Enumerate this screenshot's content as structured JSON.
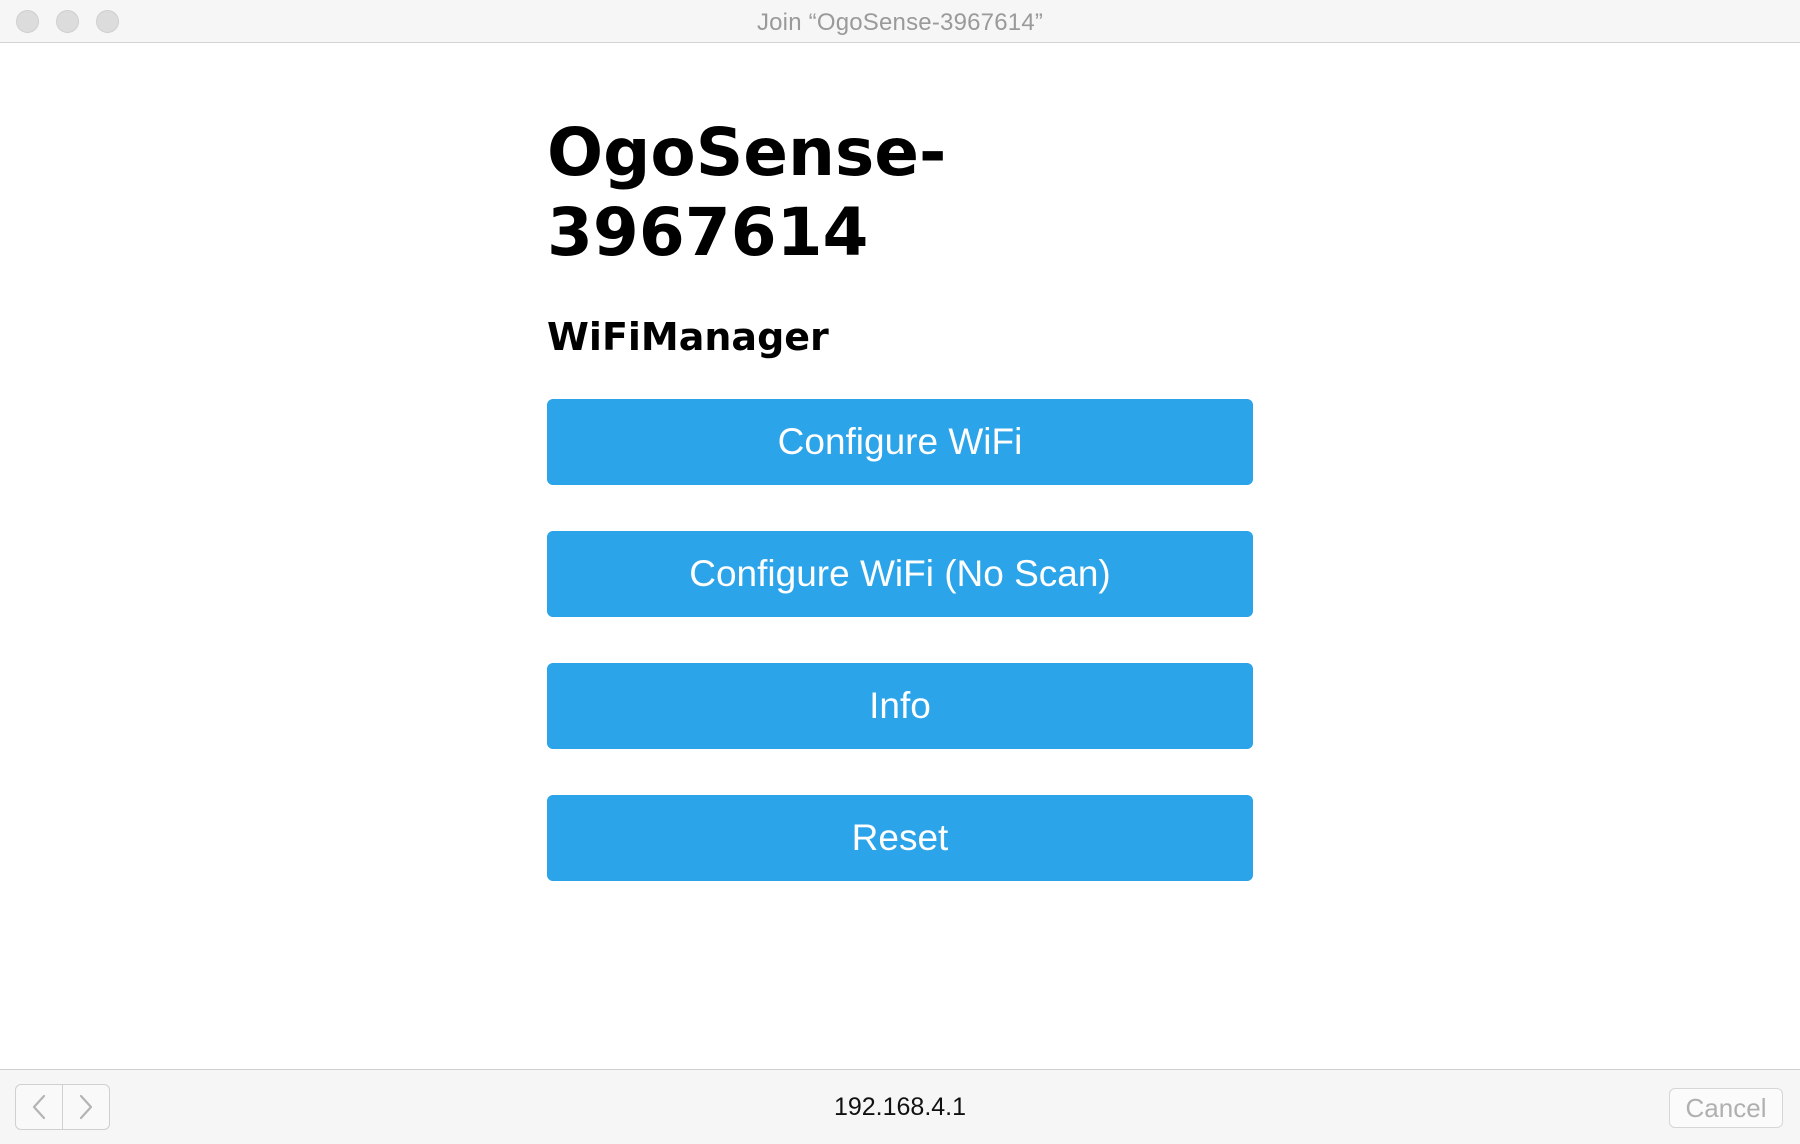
{
  "window": {
    "title": "Join “OgoSense-3967614”"
  },
  "page": {
    "heading": "OgoSense-3967614",
    "subheading": "WiFiManager"
  },
  "buttons": [
    {
      "label": "Configure WiFi"
    },
    {
      "label": "Configure WiFi (No Scan)"
    },
    {
      "label": "Info"
    },
    {
      "label": "Reset"
    }
  ],
  "bottom_bar": {
    "url": "192.168.4.1",
    "cancel_label": "Cancel",
    "back_icon": "chevron-left-icon",
    "forward_icon": "chevron-right-icon"
  },
  "colors": {
    "button_bg": "#2ba4ea",
    "button_text": "#ffffff"
  }
}
